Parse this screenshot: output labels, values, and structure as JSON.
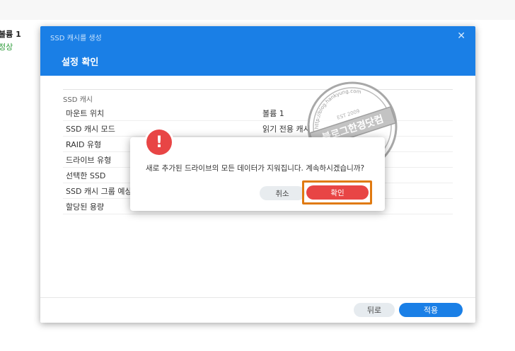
{
  "background": {
    "volume_label": "볼륨 1",
    "status_text": "정상"
  },
  "wizard": {
    "title": "SSD 캐시를 생성",
    "close_glyph": "✕",
    "step_title": "설정 확인",
    "section_label": "SSD 캐시",
    "rows": [
      {
        "key": "마운트 위치",
        "value": "볼륨 1"
      },
      {
        "key": "SSD 캐시 모드",
        "value": "읽기 전용 캐시"
      },
      {
        "key": "RAID 유형",
        "value": ""
      },
      {
        "key": "드라이브 유형",
        "value": ""
      },
      {
        "key": "선택한 SSD",
        "value": ""
      },
      {
        "key": "SSD 캐시 그룹 예상",
        "value": ""
      },
      {
        "key": "할당된 용량",
        "value": ""
      }
    ],
    "back_label": "뒤로",
    "apply_label": "적용"
  },
  "dialog": {
    "icon": "exclamation-icon",
    "icon_glyph": "!",
    "message": "새로 추가된 드라이브의 모든 데이터가 지워집니다. 계속하시겠습니까?",
    "cancel_label": "취소",
    "confirm_label": "확인"
  },
  "watermark": {
    "main_text": "블로그한경닷컴",
    "est_text": "EST 2009",
    "url_text": "http://blog.hankyung.com"
  },
  "colors": {
    "header_blue": "#1a7fe6",
    "danger_red": "#e84545",
    "highlight_orange": "#e07a10"
  }
}
